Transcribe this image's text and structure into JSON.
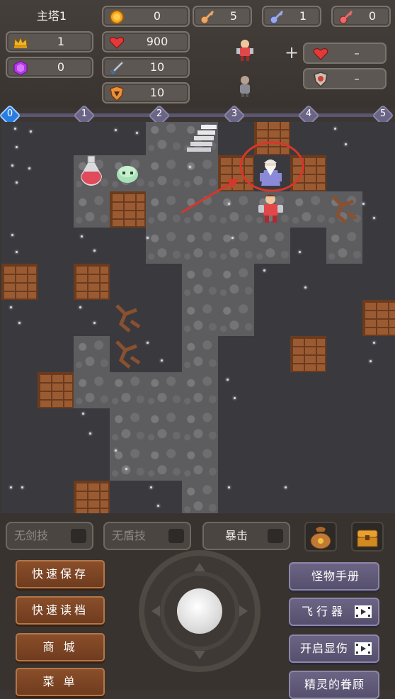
{
  "hud": {
    "floor_name": "主塔1",
    "level": "1",
    "gems": "0",
    "gold": "0",
    "hp": "900",
    "attack": "10",
    "defense": "10",
    "yellow_keys": "5",
    "blue_keys": "1",
    "red_keys": "0",
    "buff_hp": "–",
    "buff_def": "–"
  },
  "floor_bar": {
    "floors": [
      "0",
      "1",
      "2",
      "3",
      "4",
      "5"
    ],
    "current": "0"
  },
  "skills": {
    "sword": "无剑技",
    "shield": "无盾技",
    "crit": "暴击"
  },
  "left_menu": {
    "quick_save": "快速保存",
    "quick_load": "快速读档",
    "shop": "商 城",
    "menu": "菜 单"
  },
  "right_menu": {
    "monster_book": "怪物手册",
    "fly": "飞行器",
    "show_damage": "开启显伤",
    "fairy_favor": "精灵的眷顾"
  },
  "icons": [
    "crown-icon",
    "gem-icon",
    "coin-icon",
    "heart-icon",
    "sword-icon",
    "shield-icon",
    "yellow-key-icon",
    "blue-key-icon",
    "red-key-icon",
    "loot-bag-icon",
    "treasure-chest-icon",
    "film-icon"
  ],
  "colors": {
    "accent_blue": "#2a7de0",
    "brown_button": "#8a4e2a",
    "purple_button": "#6c6484",
    "annotation_red": "#d8362a"
  }
}
